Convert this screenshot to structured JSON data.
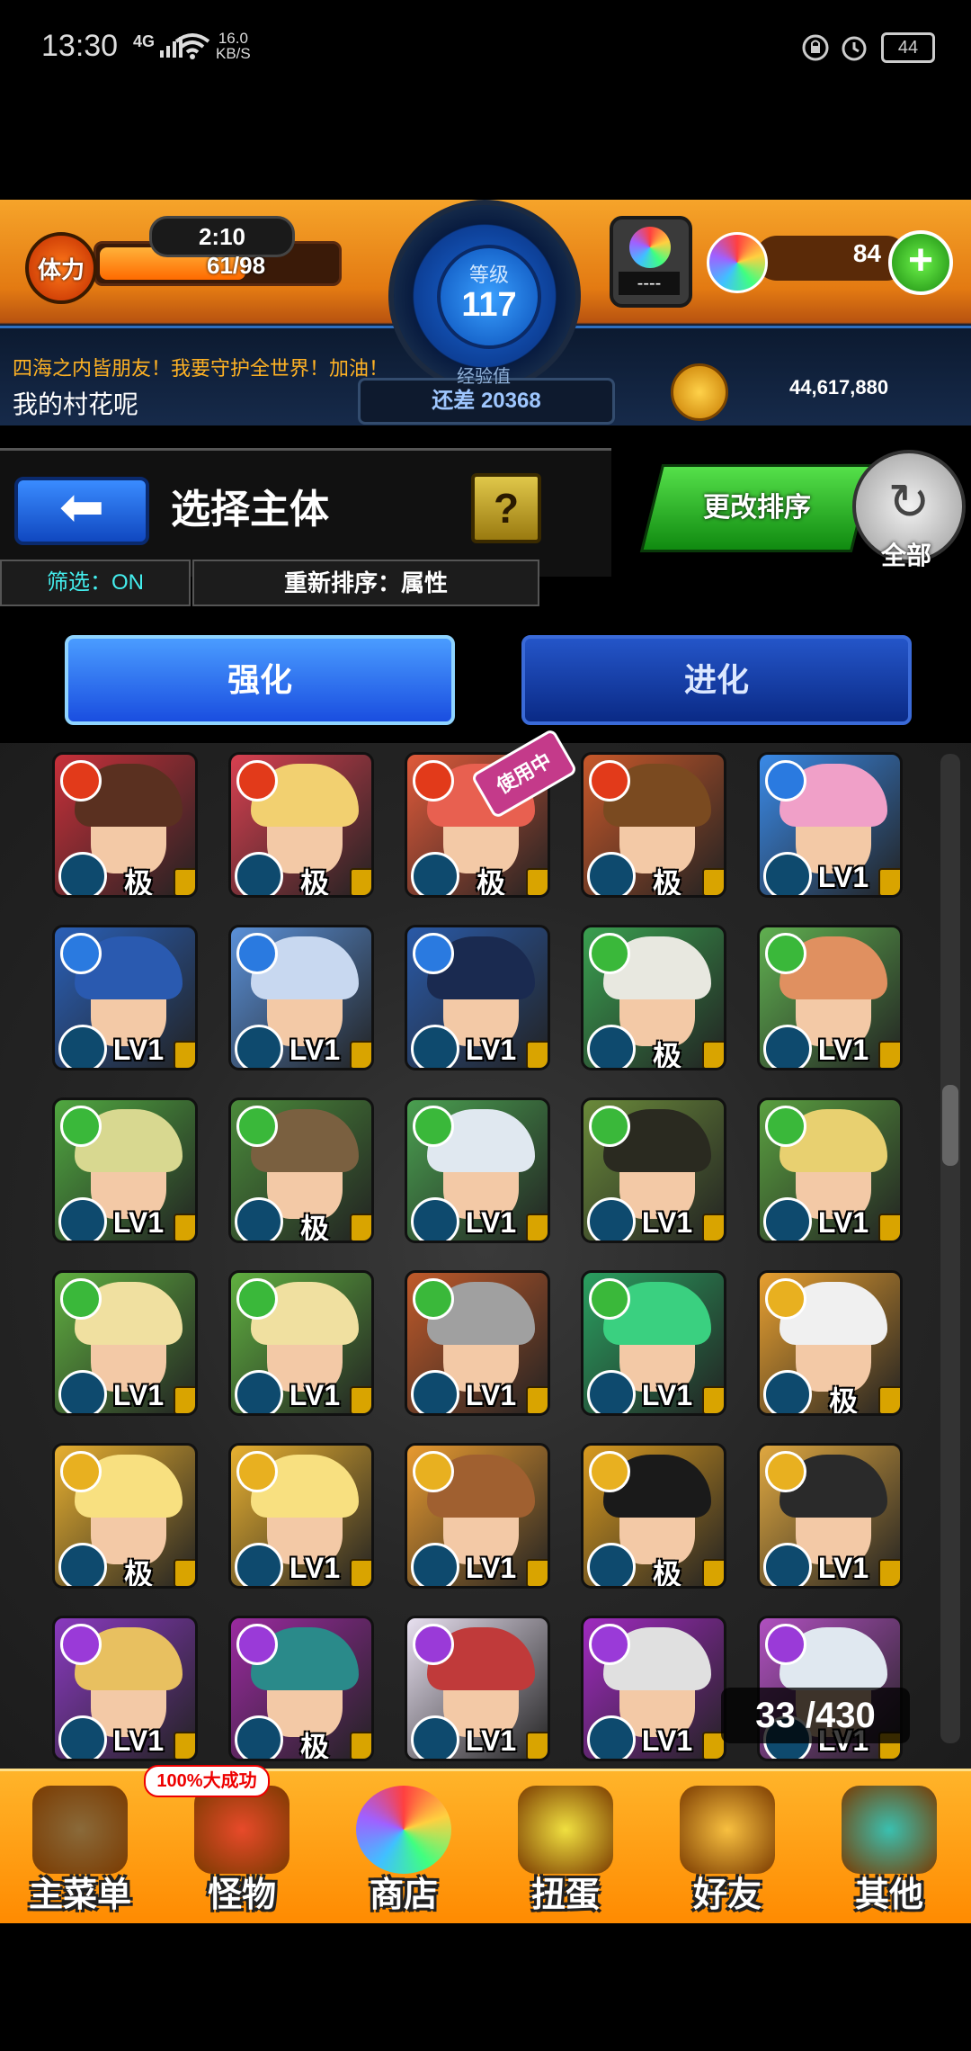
{
  "status_bar": {
    "time": "13:30",
    "network": "4G",
    "speed_value": "16.0",
    "speed_unit": "KB/S",
    "battery": "44"
  },
  "hud": {
    "stamina_label": "体力",
    "stamina_timer": "2:10",
    "stamina_value": "61/98",
    "stamina_fraction": 0.62,
    "level_label": "等级",
    "level": "117",
    "exp_label": "经验值",
    "exp_remaining": "还差 20368",
    "gem_slot": "----",
    "orb_count": "84",
    "orb_add": "+",
    "slogan": "四海之内皆朋友！我要守护全世界！加油！",
    "username": "我的村花呢",
    "coins": "44,617,880"
  },
  "title_area": {
    "back_icon": "back-arrow-icon",
    "title": "选择主体",
    "help": "?",
    "filter": "筛选：ON",
    "sort": "重新排序：属性",
    "change_sort": "更改排序",
    "all": "全部"
  },
  "mode_tabs": {
    "power_up": "强化",
    "evolve": "进化"
  },
  "monsters": [
    {
      "elem": "#e23a1a",
      "hair": "#5a3020",
      "bg": "#c8303a",
      "label": "极"
    },
    {
      "elem": "#e23a1a",
      "hair": "#f2d070",
      "bg": "#d84050",
      "label": "极"
    },
    {
      "elem": "#e23a1a",
      "hair": "#e86050",
      "bg": "#e05a3a",
      "label": "极",
      "in_use": "使用中"
    },
    {
      "elem": "#e23a1a",
      "hair": "#7a4a20",
      "bg": "#c8582a",
      "label": "极"
    },
    {
      "elem": "#2a7ae0",
      "hair": "#f0a0c8",
      "bg": "#3a8ae8",
      "label": "LV1"
    },
    {
      "elem": "#2a7ae0",
      "hair": "#2a5ab0",
      "bg": "#2a60b8",
      "label": "LV1"
    },
    {
      "elem": "#2a7ae0",
      "hair": "#c8d8f0",
      "bg": "#5a90d8",
      "label": "LV1"
    },
    {
      "elem": "#2a7ae0",
      "hair": "#1a2a50",
      "bg": "#2a5aa8",
      "label": "LV1"
    },
    {
      "elem": "#3ab83a",
      "hair": "#e8e8e0",
      "bg": "#3aa050",
      "label": "极"
    },
    {
      "elem": "#3ab83a",
      "hair": "#e09060",
      "bg": "#60b050",
      "label": "LV1"
    },
    {
      "elem": "#3ab83a",
      "hair": "#d8d890",
      "bg": "#50a840",
      "label": "LV1"
    },
    {
      "elem": "#3ab83a",
      "hair": "#7a6040",
      "bg": "#4a8a3a",
      "label": "极"
    },
    {
      "elem": "#3ab83a",
      "hair": "#e0e8f0",
      "bg": "#4aa050",
      "label": "LV1"
    },
    {
      "elem": "#3ab83a",
      "hair": "#2a2a20",
      "bg": "#6a8a3a",
      "label": "LV1"
    },
    {
      "elem": "#3ab83a",
      "hair": "#e8d070",
      "bg": "#5aa040",
      "label": "LV1"
    },
    {
      "elem": "#3ab83a",
      "hair": "#f0e0a0",
      "bg": "#60b040",
      "label": "LV1"
    },
    {
      "elem": "#3ab83a",
      "hair": "#f0e0a0",
      "bg": "#60b040",
      "label": "LV1"
    },
    {
      "elem": "#3ab83a",
      "hair": "#a0a0a0",
      "bg": "#c05a2a",
      "label": "LV1"
    },
    {
      "elem": "#3ab83a",
      "hair": "#3ad080",
      "bg": "#2aa060",
      "label": "LV1"
    },
    {
      "elem": "#e8b020",
      "hair": "#f0f0f0",
      "bg": "#e8a030",
      "label": "极"
    },
    {
      "elem": "#e8b020",
      "hair": "#f8e080",
      "bg": "#e8b030",
      "label": "极"
    },
    {
      "elem": "#e8b020",
      "hair": "#f8e080",
      "bg": "#e8b030",
      "label": "LV1"
    },
    {
      "elem": "#e8b020",
      "hair": "#a06030",
      "bg": "#e89a30",
      "label": "LV1"
    },
    {
      "elem": "#e8b020",
      "hair": "#1a1a1a",
      "bg": "#d89a20",
      "label": "极"
    },
    {
      "elem": "#e8b020",
      "hair": "#2a2a2a",
      "bg": "#e0a840",
      "label": "LV1"
    },
    {
      "elem": "#9a3ad8",
      "hair": "#e8c060",
      "bg": "#8a3ac0",
      "label": "LV1"
    },
    {
      "elem": "#9a3ad8",
      "hair": "#2a8a8a",
      "bg": "#9a2aa0",
      "label": "极"
    },
    {
      "elem": "#9a3ad8",
      "hair": "#c03a3a",
      "bg": "#e8e0f0",
      "label": "LV1"
    },
    {
      "elem": "#9a3ad8",
      "hair": "#e0e0e0",
      "bg": "#a02ac0",
      "label": "LV1"
    },
    {
      "elem": "#9a3ad8",
      "hair": "#e0e8f0",
      "bg": "#b050c0",
      "label": "LV1"
    }
  ],
  "count_badge": "33 /430",
  "bottom_nav": [
    {
      "label": "主菜单",
      "icon": "menu-gate-icon",
      "color": "#8a6a3a"
    },
    {
      "label": "怪物",
      "icon": "monster-icon",
      "color": "#e84a2a"
    },
    {
      "label": "商店",
      "icon": "orb-shop-icon",
      "color": "rainbow"
    },
    {
      "label": "扭蛋",
      "icon": "egg-icon",
      "color": "#f0e040"
    },
    {
      "label": "好友",
      "icon": "friends-icon",
      "color": "#f8c040"
    },
    {
      "label": "其他",
      "icon": "other-icon",
      "color": "#3ac0b0"
    }
  ],
  "nav_badge": "100%大成功"
}
